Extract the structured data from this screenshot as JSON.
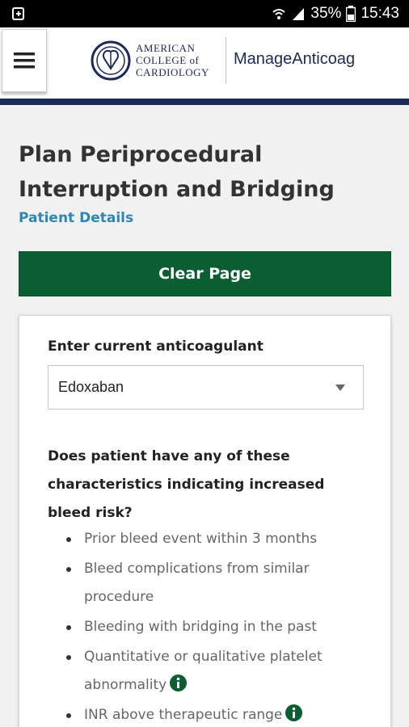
{
  "status_bar": {
    "battery": "35%",
    "time": "15:43"
  },
  "header": {
    "logo_lines": [
      "AMERICAN",
      "COLLEGE of",
      "CARDIOLOGY"
    ],
    "brand": "ManageAnticoag"
  },
  "page": {
    "title": "Plan Periprocedural Interruption and Bridging",
    "subtitle": "Patient Details",
    "clear_button": "Clear Page"
  },
  "form": {
    "anticoagulant_label": "Enter current anticoagulant",
    "anticoagulant_value": "Edoxaban",
    "bleed_question": "Does patient have any of these characteristics indicating increased bleed risk?",
    "bleed_items": [
      "Prior bleed event within 3 months",
      "Bleed complications from similar procedure",
      "Bleeding with bridging in the past",
      "Quantitative or qualitative platelet abnormality",
      "INR above therapeutic range"
    ]
  },
  "colors": {
    "brand_navy": "#1c2b57",
    "button_green": "#0b5e32",
    "link_blue": "#2e86b3",
    "info_green": "#0b5e32"
  },
  "icons": [
    "sim-icon",
    "wifi-icon",
    "signal-icon",
    "battery-icon",
    "menu-icon",
    "acc-seal-icon",
    "caret-down-icon",
    "info-icon"
  ]
}
